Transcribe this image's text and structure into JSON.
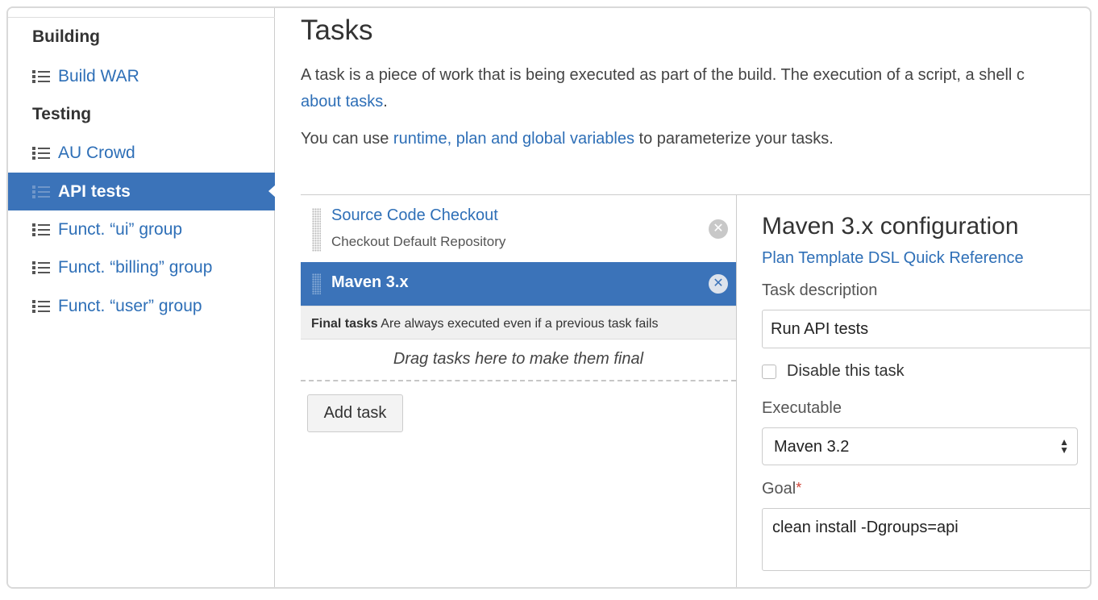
{
  "sidebar": {
    "sections": [
      {
        "heading": "Building",
        "items": [
          {
            "label": "Build WAR"
          }
        ]
      },
      {
        "heading": "Testing",
        "items": [
          {
            "label": "AU Crowd"
          },
          {
            "label": "API tests",
            "active": true
          },
          {
            "label": "Funct. “ui” group"
          },
          {
            "label": "Funct. “billing” group"
          },
          {
            "label": "Funct. “user” group"
          }
        ]
      }
    ],
    "item_icon": "list-icon"
  },
  "main": {
    "title": "Tasks",
    "intro": {
      "line1": "A task is a piece of work that is being executed as part of the build. The execution of a script, a shell c",
      "line2_link": "about tasks",
      "line2_suffix": ".",
      "line3_prefix": "You can use ",
      "line3_link": "runtime, plan and global variables",
      "line3_suffix": " to parameterize your tasks."
    },
    "tasks": [
      {
        "name": "Source Code Checkout",
        "description": "Checkout Default Repository",
        "selected": false,
        "remove_icon": "close-icon"
      },
      {
        "name": "Maven 3.x",
        "description": "",
        "selected": true,
        "remove_icon": "close-icon"
      }
    ],
    "final_tasks": {
      "label": "Final tasks",
      "description": "Are always executed even if a previous task fails",
      "drop_hint": "Drag tasks here to make them final"
    },
    "add_task_label": "Add task"
  },
  "config": {
    "title": "Maven 3.x configuration",
    "reference_link": "Plan Template DSL Quick Reference",
    "task_description_label": "Task description",
    "task_description_value": "Run API tests",
    "disable_label": "Disable this task",
    "disable_checked": false,
    "executable_label": "Executable",
    "executable_value": "Maven 3.2",
    "goal_label": "Goal",
    "goal_required_mark": "*",
    "goal_value": "clean install -Dgroups=api"
  },
  "colors": {
    "accent": "#3b73b9",
    "link": "#2e6fb7",
    "required": "#d04437"
  }
}
